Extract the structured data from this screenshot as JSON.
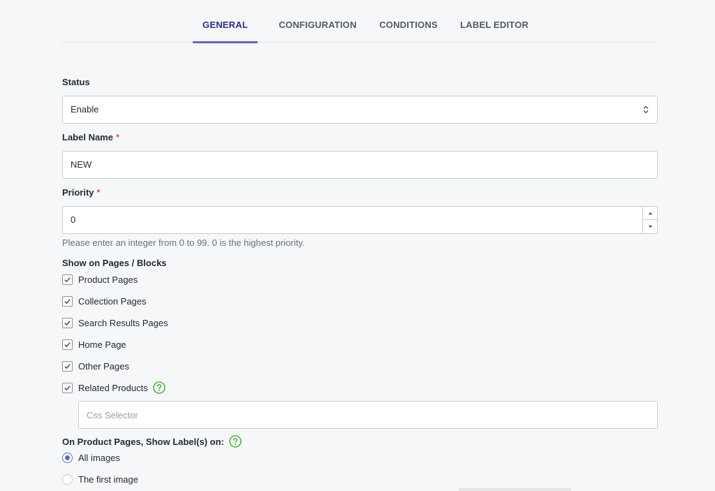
{
  "tabs": [
    {
      "label": "GENERAL",
      "active": true
    },
    {
      "label": "CONFIGURATION",
      "active": false
    },
    {
      "label": "CONDITIONS",
      "active": false
    },
    {
      "label": "LABEL EDITOR",
      "active": false
    }
  ],
  "status": {
    "label": "Status",
    "value": "Enable"
  },
  "label_name": {
    "label": "Label Name",
    "required_marker": "*",
    "value": "NEW"
  },
  "priority": {
    "label": "Priority",
    "required_marker": "*",
    "value": "0",
    "help": "Please enter an integer from 0 to 99. 0 is the highest priority."
  },
  "show_on": {
    "label": "Show on Pages / Blocks",
    "items": [
      {
        "label": "Product Pages",
        "checked": true
      },
      {
        "label": "Collection Pages",
        "checked": true
      },
      {
        "label": "Search Results Pages",
        "checked": true
      },
      {
        "label": "Home Page",
        "checked": true
      },
      {
        "label": "Other Pages",
        "checked": true
      },
      {
        "label": "Related Products",
        "checked": true
      }
    ],
    "css_selector_placeholder": "Css Selector"
  },
  "product_pages_show": {
    "label": "On Product Pages, Show Label(s) on:",
    "options": [
      {
        "label": "All images",
        "selected": true
      },
      {
        "label": "The first image",
        "selected": false
      }
    ]
  },
  "colors": {
    "accent": "#5c6ac4",
    "active_tab": "#2b2e8c",
    "help_icon": "#50b83c",
    "required": "#bf0711"
  }
}
